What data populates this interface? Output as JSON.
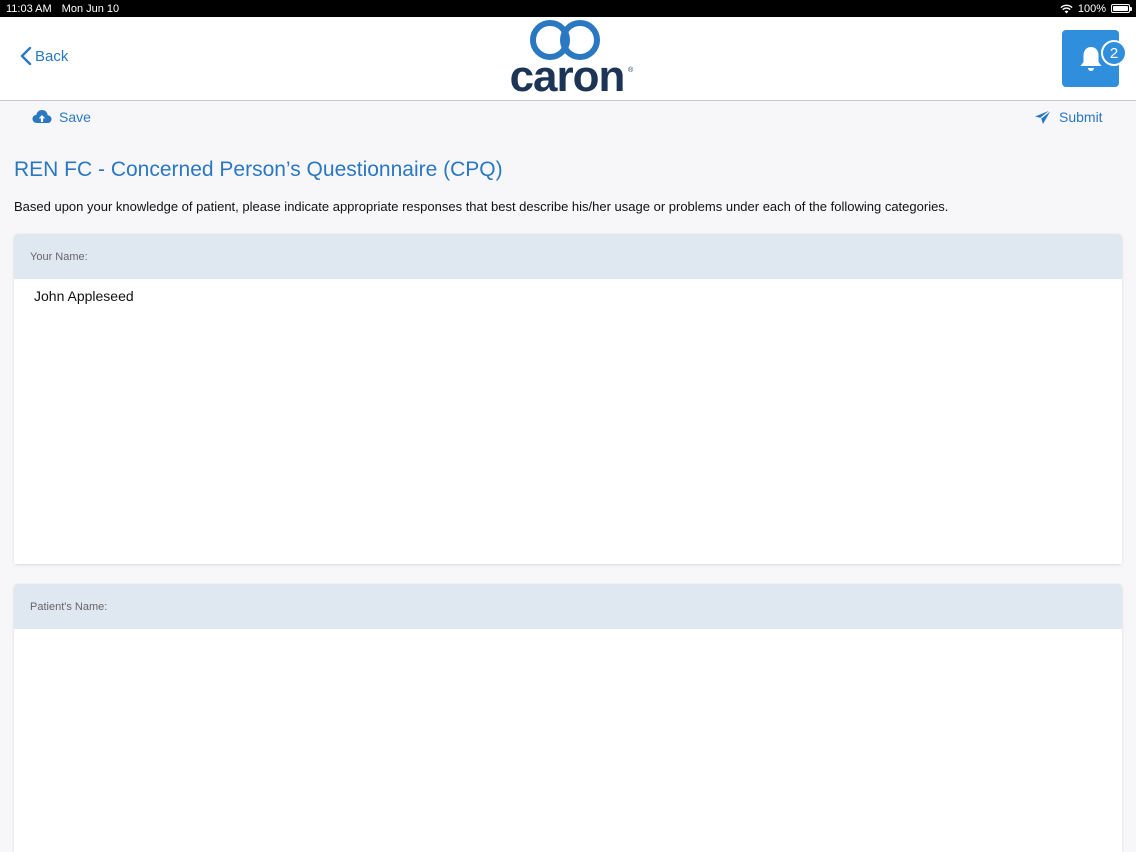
{
  "status_bar": {
    "time": "11:03 AM",
    "date": "Mon Jun 10",
    "battery": "100%"
  },
  "nav": {
    "back_label": "Back",
    "logo_text": "caron",
    "logo_mark": "®",
    "notification_count": "2"
  },
  "toolbar": {
    "save_label": "Save",
    "submit_label": "Submit"
  },
  "form": {
    "title": "REN FC - Concerned Person’s Questionnaire (CPQ)",
    "instructions": "Based upon your knowledge of patient, please indicate appropriate responses that best describe his/her usage or problems under each of the following categories.",
    "fields": [
      {
        "label": "Your Name:",
        "value": "John Appleseed"
      },
      {
        "label": "Patient's Name:",
        "value": ""
      }
    ]
  },
  "colors": {
    "accent": "#2a78c2",
    "bell_button": "#2f8fdd",
    "logo": "#1c3556",
    "section_header": "#dfe7f0"
  },
  "icons": [
    "chevron-left-icon",
    "cloud-upload-icon",
    "paper-plane-icon",
    "bell-icon",
    "wifi-icon",
    "battery-icon"
  ]
}
